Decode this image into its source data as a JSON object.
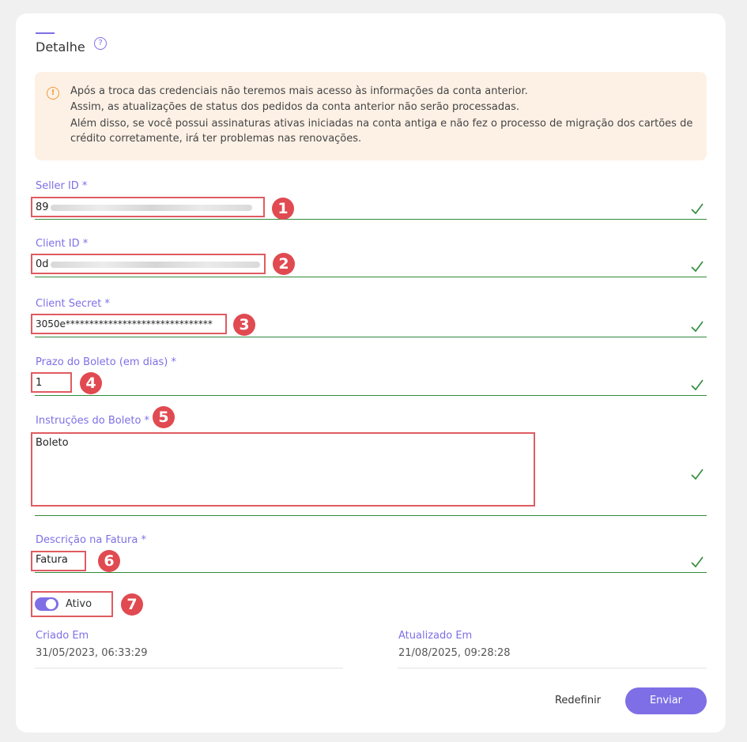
{
  "header": {
    "title": "Detalhe",
    "help_icon": "help-circle-icon"
  },
  "alert": {
    "icon": "warning-circle-icon",
    "color": "#fdf1e6",
    "lines": [
      "Após a troca das credenciais não teremos mais acesso às informações da conta anterior.",
      "Assim, as atualizações de status dos pedidos da conta anterior não serão processadas.",
      "Além disso, se você possui assinaturas ativas iniciadas na conta antiga e não fez o processo de migração dos cartões de",
      "crédito corretamente, irá ter problemas nas renovações."
    ]
  },
  "fields": {
    "seller_id": {
      "label": "Seller ID *",
      "value": "89"
    },
    "client_id": {
      "label": "Client ID *",
      "value": "0d"
    },
    "client_secret": {
      "label": "Client Secret *",
      "value": "3050e*******************************"
    },
    "prazo": {
      "label": "Prazo do Boleto (em dias) *",
      "value": "1"
    },
    "instrucoes": {
      "label": "Instruções do Boleto *",
      "value": "Boleto"
    },
    "descricao": {
      "label": "Descrição na Fatura *",
      "value": "Fatura"
    }
  },
  "toggle": {
    "label": "Ativo",
    "on": true
  },
  "meta": {
    "created_label": "Criado Em",
    "created_value": "31/05/2023, 06:33:29",
    "updated_label": "Atualizado Em",
    "updated_value": "21/08/2025, 09:28:28"
  },
  "actions": {
    "reset_label": "Redefinir",
    "submit_label": "Enviar"
  },
  "annotations": [
    "1",
    "2",
    "3",
    "4",
    "5",
    "6",
    "7"
  ],
  "colors": {
    "accent": "#7e6fe6",
    "valid": "#2e8b3a",
    "annotation": "#e04a50"
  }
}
